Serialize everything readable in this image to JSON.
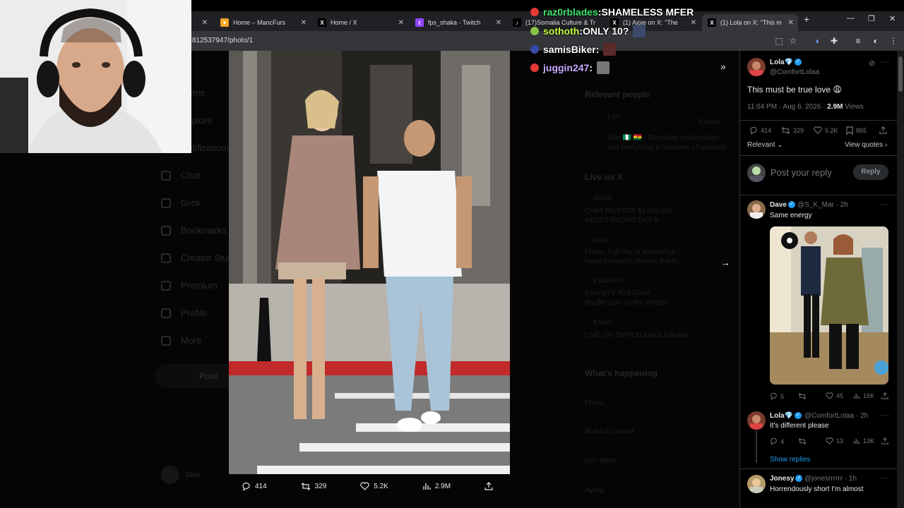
{
  "browser": {
    "tabs": [
      {
        "label": "Home – MancFurs",
        "icon": "fox-icon",
        "color": "#f5a623"
      },
      {
        "label": "Home / X",
        "icon": "x-icon",
        "color": "#000000"
      },
      {
        "label": "fps_shaka - Twitch",
        "icon": "twitch-icon",
        "color": "#9146ff"
      },
      {
        "label": "(17)Somalia Culture & Tr",
        "icon": "tiktok-icon",
        "color": "#000000"
      },
      {
        "label": "(1) Ajoje on X: \"The",
        "icon": "x-icon",
        "color": "#000000"
      },
      {
        "label": "(1) Lola on X: \"This m",
        "icon": "x-icon",
        "color": "#000000"
      }
    ],
    "url": "812537947/photo/1",
    "new_tab": "+",
    "minimize": "—",
    "maximize": "❐",
    "close": "✕"
  },
  "background_nav": {
    "items": [
      "Home",
      "Explore",
      "Notifications",
      "Chat",
      "Grok",
      "Bookmarks",
      "Creator Studio",
      "Premium",
      "Profile",
      "More"
    ],
    "post_button": "Post",
    "profile_name": "Slike"
  },
  "background_right": {
    "relevant_title": "Relevant people",
    "relevant_name": "Lola",
    "follow": "Follow",
    "relevant_bio_1": "God 🇳🇬 🇬🇭 | Decoding relationships",
    "relevant_bio_2": "and everything in between | Facebook",
    "live_title": "Live on X",
    "live_1_name": "Mizkif",
    "live_1_text_1": "CHAT INVESTS $1,000,000",
    "live_1_text_2": "KEEPS PROFIT DAY 5-...",
    "live_2_name": "Kool",
    "live_2_text_1": "Friday, Full day of streaming! |",
    "live_2_text_2": "kalap livewatch #twitter #nbet...",
    "live_3_name": "EsfandTV",
    "live_3_text_1": "EsfandTV  Red Circle",
    "live_3_text_2": "Shuffle Live on the #rebels",
    "live_4_name": "Kathe",
    "live_4_text_1": "LIVE ON TWITCH twitch.tv/kathe",
    "happening_title": "What's happening",
    "trend_1": "Frodo",
    "trend_2": "Abdul El-Sayed",
    "trend_3": "Kim Wilde",
    "trend_4": "Ayling"
  },
  "photo_actions": {
    "replies": "414",
    "reposts": "329",
    "likes": "5.2K",
    "views": "2.9M"
  },
  "tweet": {
    "name": "Lola💎",
    "handle": "@ComfortLolaa",
    "text": "This must be true love 😩",
    "time": "11:04 PM · Aug 6, 2026 · ",
    "views_count": "2.9M",
    "views_label": " Views",
    "replies": "414",
    "reposts": "329",
    "likes": "5.2K",
    "bookmarks": "865",
    "sort": "Relevant",
    "view_quotes": "View quotes",
    "reply_placeholder": "Post your reply",
    "reply_button": "Reply"
  },
  "replies": [
    {
      "name": "Dave",
      "handle": "@S_K_Mar · 2h",
      "text": "Same energy",
      "replies": "5",
      "reposts": "",
      "likes": "45",
      "views": "16K"
    },
    {
      "name": "Lola💎",
      "handle": "@ComfortLolaa · 2h",
      "text": "It's different please",
      "replies": "4",
      "reposts": "",
      "likes": "13",
      "views": "13K",
      "show_replies": "Show replies"
    },
    {
      "name": "Jonesy",
      "handle": "@jonesrrrrrr · 1h",
      "text": "Horrendously short I'm almost"
    }
  ],
  "chat": [
    {
      "user": "raz0rblades",
      "sep": " : ",
      "msg": "SHAMELESS MFER",
      "user_color": "#3fe06a",
      "badge_color": "#e53935"
    },
    {
      "user": "sothoth",
      "sep": " : ",
      "msg": "ONLY 10?",
      "user_color": "#c6ff3f",
      "badge_color": "#8bc34a"
    },
    {
      "user": "samisBiker",
      "sep": " : ",
      "msg": "",
      "user_color": "#ffffff",
      "badge_color": "#3949ab"
    },
    {
      "user": "juggin247",
      "sep": " : ",
      "msg": "",
      "user_color": "#c9a8ff",
      "badge_color": "#e53935"
    }
  ],
  "colors": {
    "accent": "#1d9bf0",
    "bg": "#000000",
    "muted": "#71767b"
  }
}
